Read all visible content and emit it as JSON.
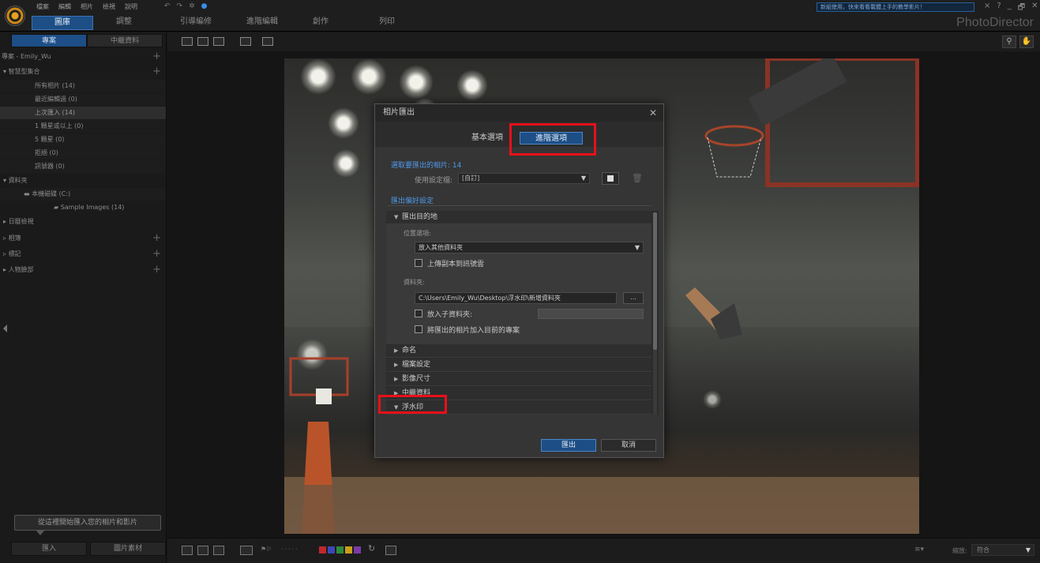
{
  "menubar": {
    "items": [
      "檔案",
      "編輯",
      "相片",
      "檢視",
      "說明"
    ],
    "quick": [
      "↶",
      "↷",
      "✲"
    ],
    "notice": "新組使用，快來看看載體上手的教學影片！",
    "notice_close": "×",
    "window_controls": [
      "?",
      "_",
      "🗗",
      "✕"
    ],
    "brand": "PhotoDirector"
  },
  "mode_tabs": [
    {
      "label": "圖庫",
      "active": true
    },
    {
      "label": "調整",
      "active": false
    }
  ],
  "work_tabs": [
    "引導編修",
    "進階編輯",
    "創作",
    "列印"
  ],
  "left_panel": {
    "tabs": [
      {
        "label": "專案",
        "active": true
      },
      {
        "label": "中繼資料",
        "active": false
      }
    ],
    "project": "專案 - Emily_Wu",
    "smart_collections_header": "智慧型集合",
    "smart_collections": [
      "所有相片 (14)",
      "最近編輯過 (0)",
      "上次匯入 (14)",
      "1 顆星或以上 (0)",
      "5 顆星 (0)",
      "拒絕 (0)",
      "訊號器 (0)"
    ],
    "folders_header": "資料夾",
    "drive": "本機磁碟 (C:)",
    "folder": "Sample Images (14)",
    "calendar": "日曆檢視",
    "albums": "相簿",
    "tags": "標記",
    "faces": "人物臉部",
    "import_hint": "從這裡開始匯入您的相片和影片",
    "bottom_buttons": [
      "匯入",
      "圖片素材"
    ]
  },
  "filmbar": {
    "zoom_label": "縮放:",
    "zoom_value": "符合",
    "color_labels": [
      "#c0282c",
      "#3c46b8",
      "#2e8a3a",
      "#c8a018",
      "#7a3aa8"
    ]
  },
  "dialog": {
    "title": "相片匯出",
    "close": "✕",
    "tabs": [
      {
        "label": "基本選項",
        "active": false
      },
      {
        "label": "進階選項",
        "active": true
      }
    ],
    "selected_count": "選取要匯出的相片: 14",
    "preset_label": "使用設定檔:",
    "preset_value": "[自訂]",
    "pref_header": "匯出偏好設定",
    "sections": {
      "destination": "匯出目的地",
      "location_label": "位置選項:",
      "location_value": "放入其他資料夾",
      "upload_label": "上傳副本到訊號雲",
      "folder_label": "資料夾:",
      "folder_path": "C:\\Users\\Emily_Wu\\Desktop\\浮水印\\新增資料夾",
      "browse": "...",
      "subfolder_label": "放入子資料夾:",
      "add_to_project_label": "將匯出的相片加入目前的專案",
      "naming": "命名",
      "file_settings": "檔案設定",
      "image_size": "影像尺寸",
      "metadata": "中繼資料",
      "watermark": "浮水印"
    },
    "export_button": "匯出",
    "cancel_button": "取消"
  },
  "colors": {
    "accent": "#1d4e86",
    "highlight": "#e8101a",
    "link": "#4f99e8"
  }
}
